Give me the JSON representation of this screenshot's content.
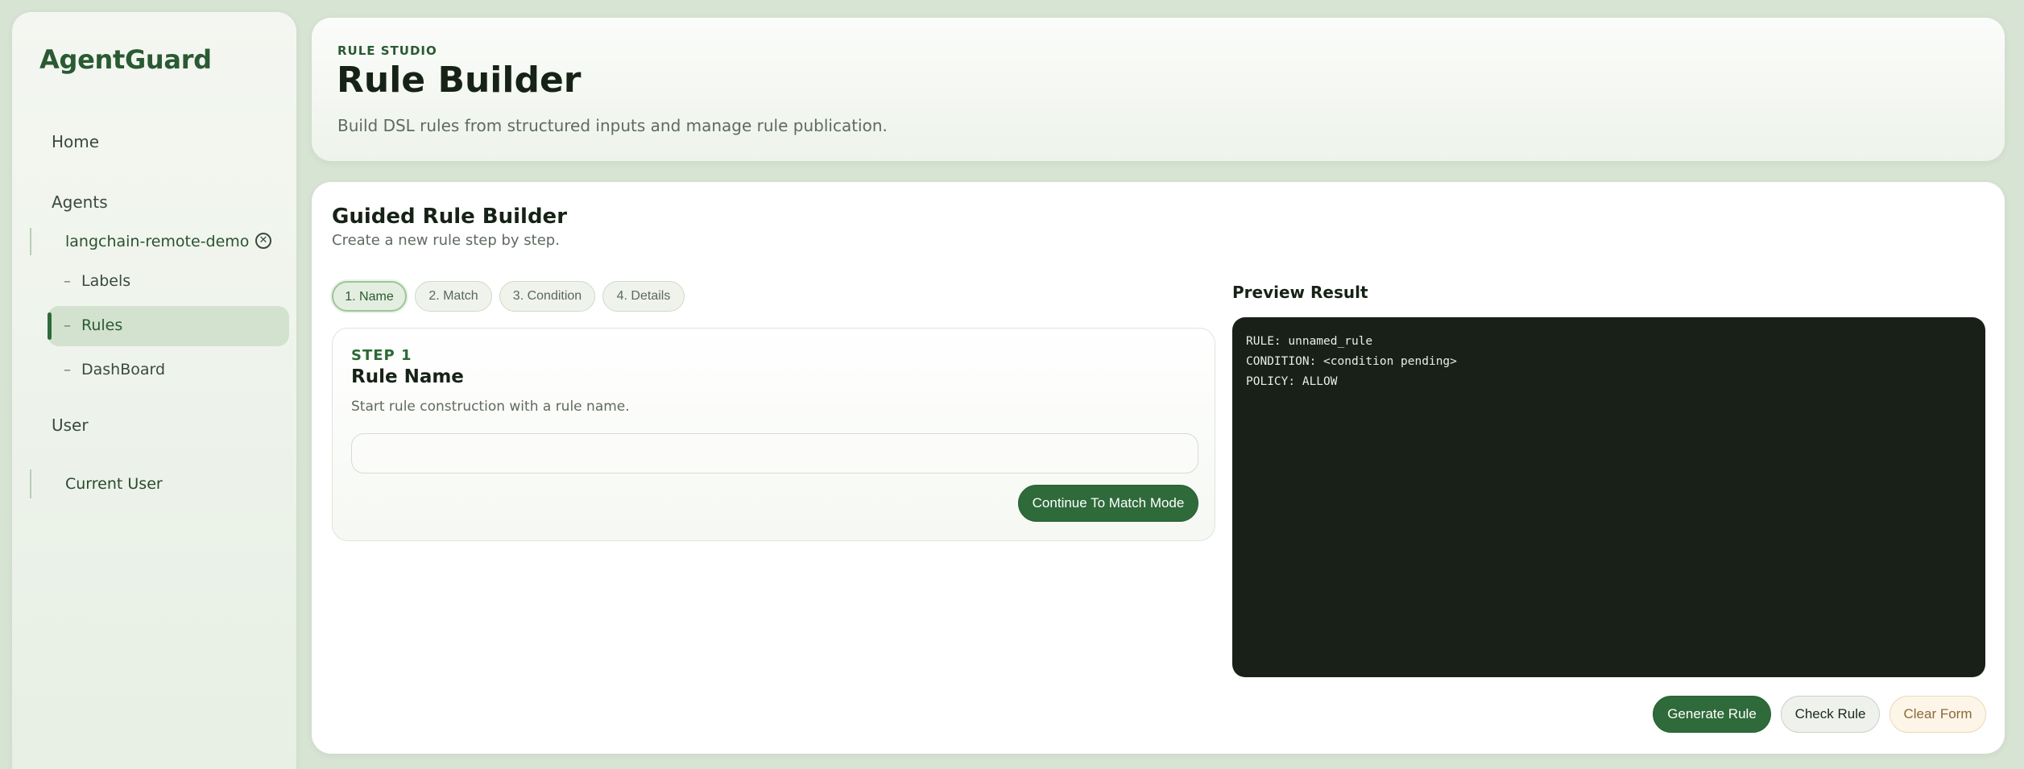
{
  "brand": "AgentGuard",
  "sidebar": {
    "home": "Home",
    "agents_heading": "Agents",
    "agent_name": "langchain-remote-demo",
    "agent_close_icon": "✕",
    "sub_items": [
      {
        "label": "Labels",
        "active": false
      },
      {
        "label": "Rules",
        "active": true
      },
      {
        "label": "DashBoard",
        "active": false
      }
    ],
    "user_heading": "User",
    "current_user": "Current User"
  },
  "header": {
    "eyebrow": "RULE STUDIO",
    "title": "Rule Builder",
    "subtitle": "Build DSL rules from structured inputs and manage rule publication."
  },
  "builder": {
    "title": "Guided Rule Builder",
    "subtitle": "Create a new rule step by step.",
    "steps": [
      {
        "label": "1. Name",
        "active": true
      },
      {
        "label": "2. Match",
        "active": false
      },
      {
        "label": "3. Condition",
        "active": false
      },
      {
        "label": "4. Details",
        "active": false
      }
    ],
    "step_panel": {
      "kicker": "STEP 1",
      "title": "Rule Name",
      "description": "Start rule construction with a rule name.",
      "input_value": "",
      "input_placeholder": "",
      "continue_label": "Continue To Match Mode"
    }
  },
  "preview": {
    "title": "Preview Result",
    "lines": [
      "RULE: unnamed_rule",
      "CONDITION: <condition pending>",
      "POLICY: ALLOW"
    ]
  },
  "actions": {
    "generate": "Generate Rule",
    "check": "Check Rule",
    "clear": "Clear Form"
  },
  "colors": {
    "accent": "#2f6a3a",
    "background": "#d7e3d3",
    "preview_bg": "#192018"
  }
}
